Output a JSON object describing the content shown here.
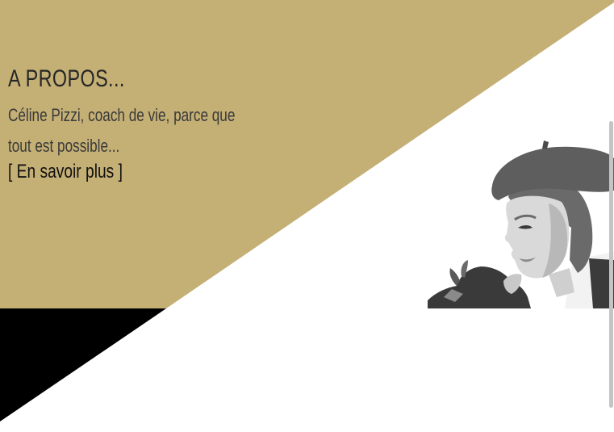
{
  "about": {
    "title": "A PROPOS...",
    "text": "Céline Pizzi, coach de vie, parce que tout est possible...",
    "link_label": "[ En savoir plus ]"
  },
  "colors": {
    "gold": "#c4af75",
    "black": "#000000",
    "white": "#ffffff",
    "photo_gray": "#5e5e5e",
    "scrollbar": "#c4c4c4"
  },
  "images": {
    "portrait": "portrait-photo"
  }
}
